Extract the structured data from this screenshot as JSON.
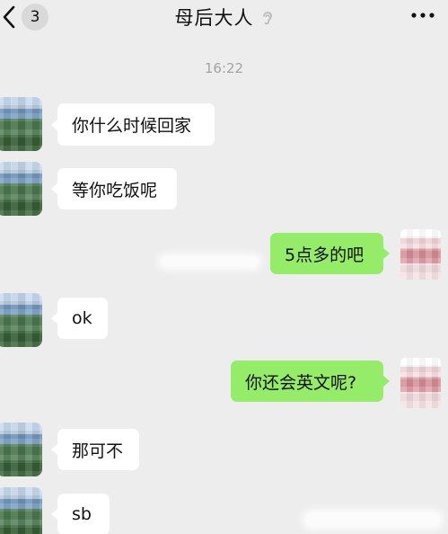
{
  "header": {
    "back_icon": "chevron-left-icon",
    "unread_count": "3",
    "title": "母后大人",
    "mute_icon": "ear-icon",
    "more_icon": "more-dots-icon"
  },
  "timestamp": "16:22",
  "messages": [
    {
      "side": "in",
      "text": "你什么时候回家"
    },
    {
      "side": "in",
      "text": "等你吃饭呢"
    },
    {
      "side": "out",
      "text": "5点多的吧"
    },
    {
      "side": "in",
      "text": "ok"
    },
    {
      "side": "out",
      "text": "你还会英文呢?"
    },
    {
      "side": "in",
      "text": "那可不"
    },
    {
      "side": "in",
      "text": "sb"
    }
  ],
  "colors": {
    "background": "#ededed",
    "incoming_bubble": "#ffffff",
    "outgoing_bubble": "#95ec69",
    "timestamp": "#a3a3a3"
  }
}
